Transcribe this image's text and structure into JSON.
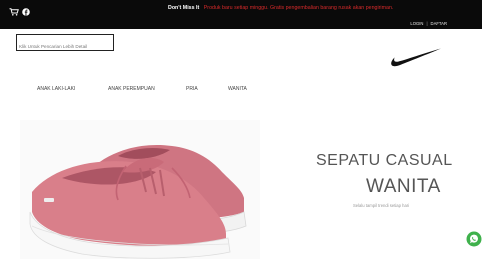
{
  "topbar": {
    "promo_title": "Don't Miss It",
    "promo_message": "Produk baru setiap minggu. Gratis pengembalian barang rusak akan pengiriman.",
    "login_label": "LOGIN",
    "separator": "|",
    "register_label": "DAFTAR"
  },
  "search": {
    "placeholder": "Klik Untuk Pencarian Lebih Detail"
  },
  "nav": {
    "items": [
      {
        "label": "ANAK LAKI-LAKI"
      },
      {
        "label": "ANAK PEREMPUAN"
      },
      {
        "label": "PRIA"
      },
      {
        "label": "WANITA"
      }
    ]
  },
  "hero": {
    "headline_line1": "SEPATU CASUAL",
    "headline_line2": "WANITA",
    "subline": "Selalu tampil trendi setiap hari"
  },
  "icons": [
    "cart-icon",
    "facebook-icon",
    "nike-logo",
    "whatsapp-icon"
  ],
  "colors": {
    "topbar": "#0a0a0a",
    "promo_message": "#d62a2a",
    "shoe_upper": "#d97f8a",
    "shoe_sole": "#f4f4f4",
    "whatsapp": "#3fb14c"
  }
}
